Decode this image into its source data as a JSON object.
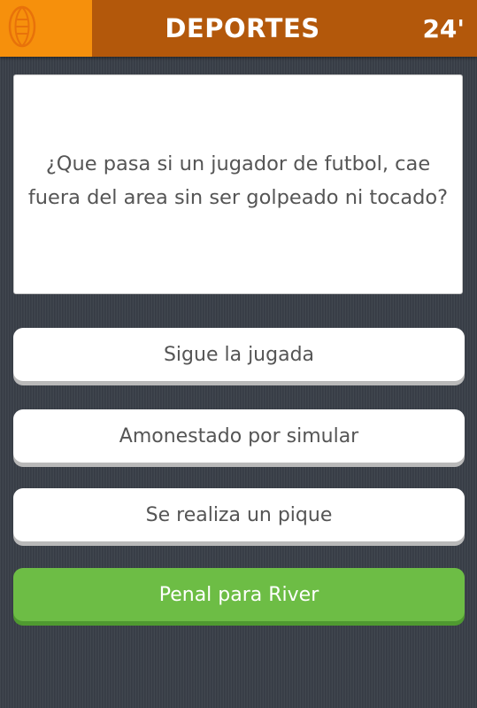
{
  "header": {
    "category_icon": "football-icon",
    "title": "DEPORTES",
    "timer": "24'",
    "colors": {
      "bar": "#b3580b",
      "category_box": "#f6900c"
    }
  },
  "question": {
    "text": "¿Que pasa si un jugador de futbol, cae fuera del area sin ser golpeado ni tocado?"
  },
  "answers": [
    {
      "label": "Sigue la jugada",
      "state": "default"
    },
    {
      "label": "Amonestado por simular",
      "state": "default"
    },
    {
      "label": "Se realiza un pique",
      "state": "default"
    },
    {
      "label": "Penal para River",
      "state": "correct"
    }
  ],
  "colors": {
    "correct": "#6dbd45",
    "background": "#3a4049"
  }
}
